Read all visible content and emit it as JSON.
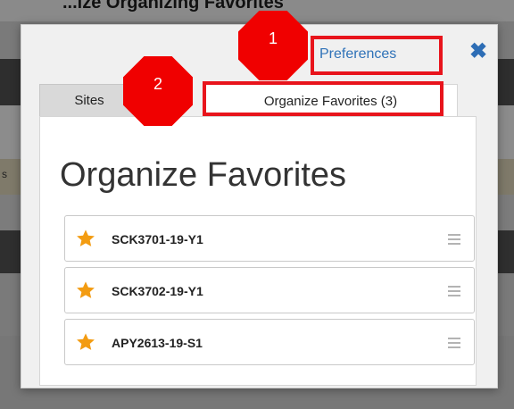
{
  "background": {
    "title_fragment": "...ize Organizing Favorites",
    "side_fragment": "s"
  },
  "modal": {
    "preferences_link": "Preferences",
    "close_icon": "close-icon",
    "close_glyph": "✖",
    "tabs": [
      {
        "label": "Sites",
        "active": false
      },
      {
        "label": "Organize Favorites (3)",
        "active": true
      }
    ],
    "panel_title": "Organize Favorites",
    "favorites": [
      {
        "label": "SCK3701-19-Y1",
        "icon": "star-icon"
      },
      {
        "label": "SCK3702-19-Y1",
        "icon": "star-icon"
      },
      {
        "label": "APY2613-19-S1",
        "icon": "star-icon"
      }
    ]
  },
  "annotations": [
    {
      "number": "1",
      "target": "Preferences"
    },
    {
      "number": "2",
      "target": "Organize Favorites (3)"
    }
  ],
  "colors": {
    "link": "#2f72b8",
    "star": "#f39c12",
    "annotation": "#f00000"
  }
}
